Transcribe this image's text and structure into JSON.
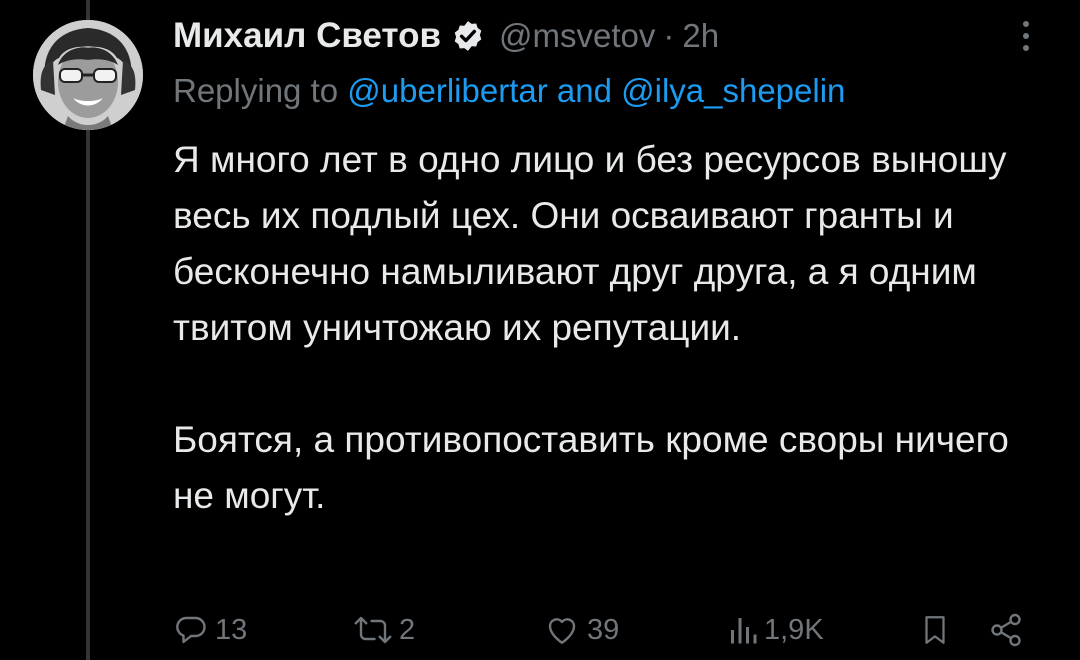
{
  "tweet": {
    "author_name": "Михаил Светов",
    "handle": "@msvetov",
    "separator": "·",
    "time": "2h",
    "reply_prefix": "Replying to",
    "reply_user_1": "@uberlibertar",
    "reply_conjunction": "and",
    "reply_user_2": "@ilya_shepelin",
    "paragraph_1": "Я много лет в одно лицо и без ресурсов выношу весь их подлый цех. Они осваивают гранты и бесконечно намыливают друг друга, а я одним твитом уничтожаю их репутации.",
    "paragraph_2": "Боятся, а противопоставить кроме своры ничего не могут."
  },
  "actions": {
    "reply_count": "13",
    "retweet_count": "2",
    "like_count": "39",
    "views_count": "1,9K"
  },
  "icons": {
    "verified": "verified-badge-icon",
    "more": "more-vertical-icon",
    "reply": "reply-icon",
    "retweet": "retweet-icon",
    "like": "heart-icon",
    "views": "views-icon",
    "bookmark": "bookmark-icon",
    "share": "share-icon"
  },
  "colors": {
    "background": "#000000",
    "text": "#e7e9ea",
    "muted": "#71767b",
    "link": "#1d9bf0"
  }
}
